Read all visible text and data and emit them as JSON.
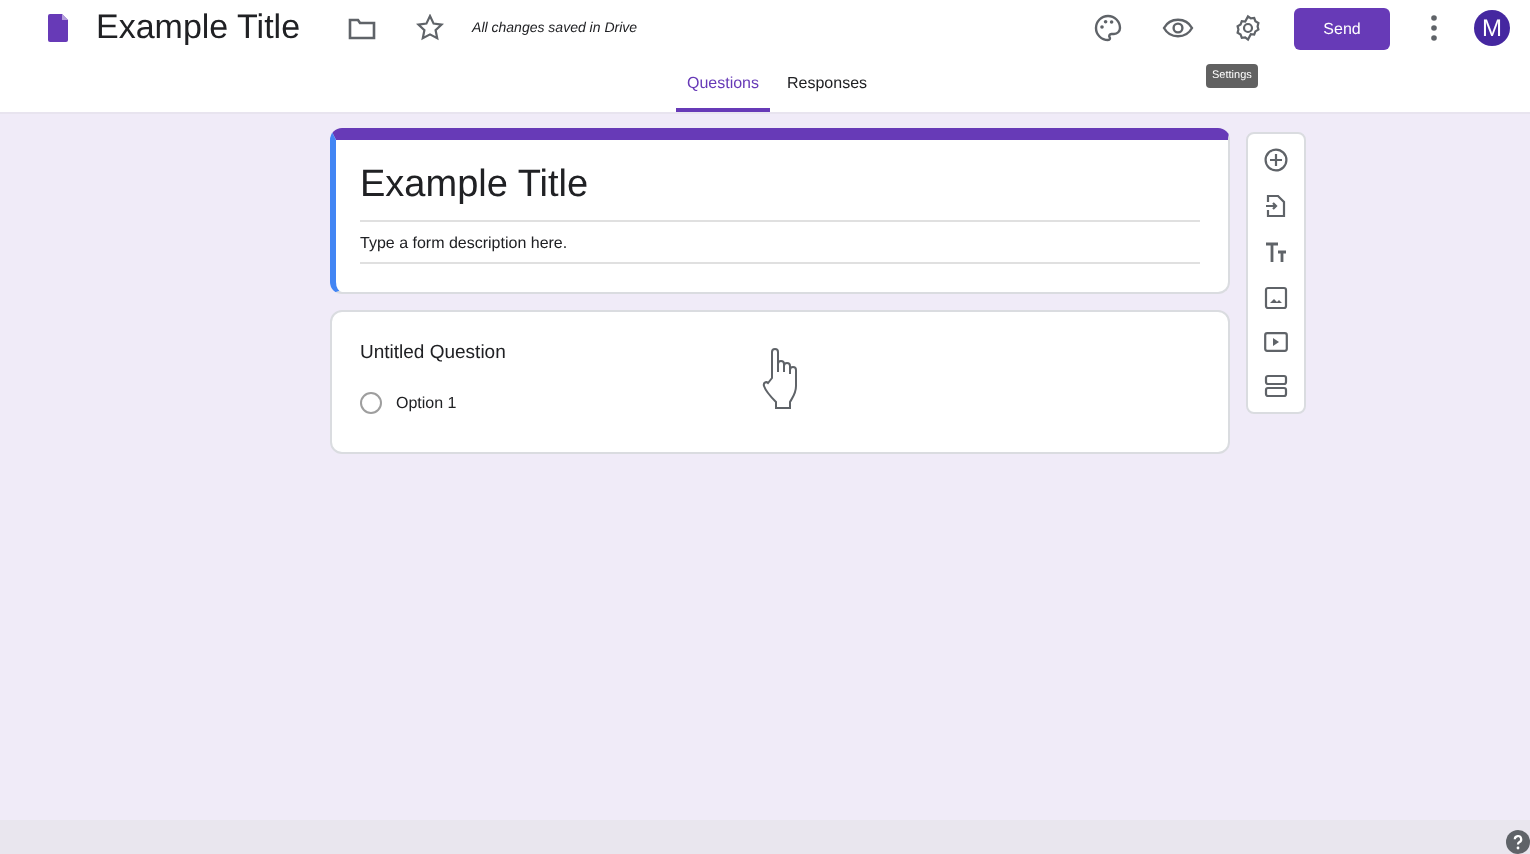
{
  "header": {
    "title": "Example Title",
    "save_status": "All changes saved in Drive",
    "send_label": "Send",
    "avatar_letter": "M",
    "tooltip": "Settings"
  },
  "tabs": [
    {
      "label": "Questions",
      "selected": true
    },
    {
      "label": "Responses",
      "selected": false
    }
  ],
  "form": {
    "title": "Example Title",
    "description": "Type a form description here."
  },
  "questions": [
    {
      "title": "Untitled Question",
      "options": [
        {
          "label": "Option 1",
          "selected": false
        }
      ]
    }
  ]
}
